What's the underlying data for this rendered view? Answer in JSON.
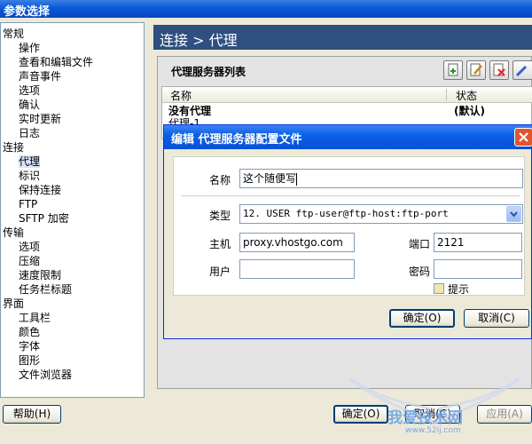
{
  "window": {
    "title": "参数选择"
  },
  "tree": {
    "items": [
      {
        "label": "常规",
        "level": 0
      },
      {
        "label": "操作",
        "level": 1
      },
      {
        "label": "查看和编辑文件",
        "level": 1
      },
      {
        "label": "声音事件",
        "level": 1
      },
      {
        "label": "选项",
        "level": 1
      },
      {
        "label": "确认",
        "level": 1
      },
      {
        "label": "实时更新",
        "level": 1
      },
      {
        "label": "日志",
        "level": 1
      },
      {
        "label": "连接",
        "level": 0
      },
      {
        "label": "代理",
        "level": 1,
        "selected": true
      },
      {
        "label": "标识",
        "level": 1
      },
      {
        "label": "保持连接",
        "level": 1
      },
      {
        "label": "FTP",
        "level": 1
      },
      {
        "label": "SFTP 加密",
        "level": 1
      },
      {
        "label": "传输",
        "level": 0
      },
      {
        "label": "选项",
        "level": 1
      },
      {
        "label": "压缩",
        "level": 1
      },
      {
        "label": "速度限制",
        "level": 1
      },
      {
        "label": "任务栏标题",
        "level": 1
      },
      {
        "label": "界面",
        "level": 0
      },
      {
        "label": "工具栏",
        "level": 1
      },
      {
        "label": "颜色",
        "level": 1
      },
      {
        "label": "字体",
        "level": 1
      },
      {
        "label": "图形",
        "level": 1
      },
      {
        "label": "文件浏览器",
        "level": 1
      }
    ]
  },
  "right": {
    "header": "连接 > 代理",
    "section_title": "代理服务器列表",
    "list": {
      "col_name": "名称",
      "col_status": "状态",
      "rows": [
        {
          "name": "没有代理",
          "status": "(默认)"
        },
        {
          "name": "代理-1",
          "status": ""
        }
      ]
    }
  },
  "dialog": {
    "title": "编辑 代理服务器配置文件",
    "name_label": "名称",
    "name_value": "这个随便写",
    "type_label": "类型",
    "type_value": "12. USER ftp-user@ftp-host:ftp-port",
    "host_label": "主机",
    "host_value": "proxy.vhostgo.com",
    "port_label": "端口",
    "port_value": "2121",
    "user_label": "用户",
    "user_value": "",
    "password_label": "密码",
    "password_value": "",
    "prompt_label": "提示",
    "ok_label": "确定(O)",
    "cancel_label": "取消(C)"
  },
  "footer": {
    "help_label": "帮助(H)",
    "ok_label": "确定(O)",
    "cancel_label": "取消(C)",
    "apply_label": "应用(A)"
  },
  "watermark": {
    "site_name": "我爱技术网",
    "site_url": "www.52ij.com"
  },
  "colors": {
    "titlebar_blue": "#0a5ad6",
    "section_header": "#2e4f80",
    "close_red": "#e2542d"
  }
}
